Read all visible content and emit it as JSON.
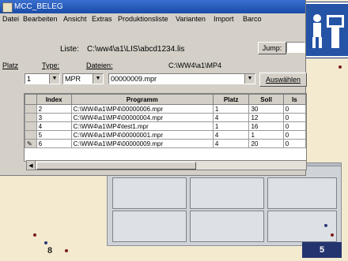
{
  "window": {
    "title": "MCC_BELEG"
  },
  "menu": {
    "items": [
      "Datei",
      "Bearbeiten",
      "Ansicht",
      "Extras",
      "Produktionsliste",
      "Varianten",
      "Import",
      "Barco"
    ]
  },
  "list": {
    "label": "Liste:",
    "path": "C:\\ww4\\a1\\LIS\\abcd1234.lis",
    "jump_label": "Jump:"
  },
  "filters": {
    "platz_label": "Platz",
    "type_label": "Type:",
    "dateien_label": "Dateien:",
    "dateien_path": "C:\\WW4\\a1\\MP4",
    "platz_value": "1",
    "type_value": "MPR",
    "file_value": "00000009.mpr",
    "select_button": "Auswählen"
  },
  "table": {
    "columns": [
      "Index",
      "Programm",
      "Platz",
      "Soll",
      "Is"
    ],
    "rows": [
      {
        "index": "2",
        "programm": "C:\\WW4\\a1\\MP4\\00000006.mpr",
        "platz": "1",
        "soll": "30",
        "ist": "0"
      },
      {
        "index": "3",
        "programm": "C:\\WW4\\a1\\MP4\\00000004.mpr",
        "platz": "4",
        "soll": "12",
        "ist": "0"
      },
      {
        "index": "4",
        "programm": "C:\\WW4\\a1\\MP4\\test1.mpr",
        "platz": "1",
        "soll": "16",
        "ist": "0"
      },
      {
        "index": "5",
        "programm": "C:\\WW4\\a1\\MP4\\00000001.mpr",
        "platz": "4",
        "soll": "1",
        "ist": "0"
      },
      {
        "index": "6",
        "programm": "C:\\WW4\\a1\\MP4\\00000009.mpr",
        "platz": "4",
        "soll": "20",
        "ist": "0"
      }
    ]
  },
  "page": {
    "left_number": "8",
    "right_number": "5"
  },
  "colors": {
    "titlebar": "#1a4ca8",
    "badge": "#24346e",
    "background": "#f3ead0"
  }
}
